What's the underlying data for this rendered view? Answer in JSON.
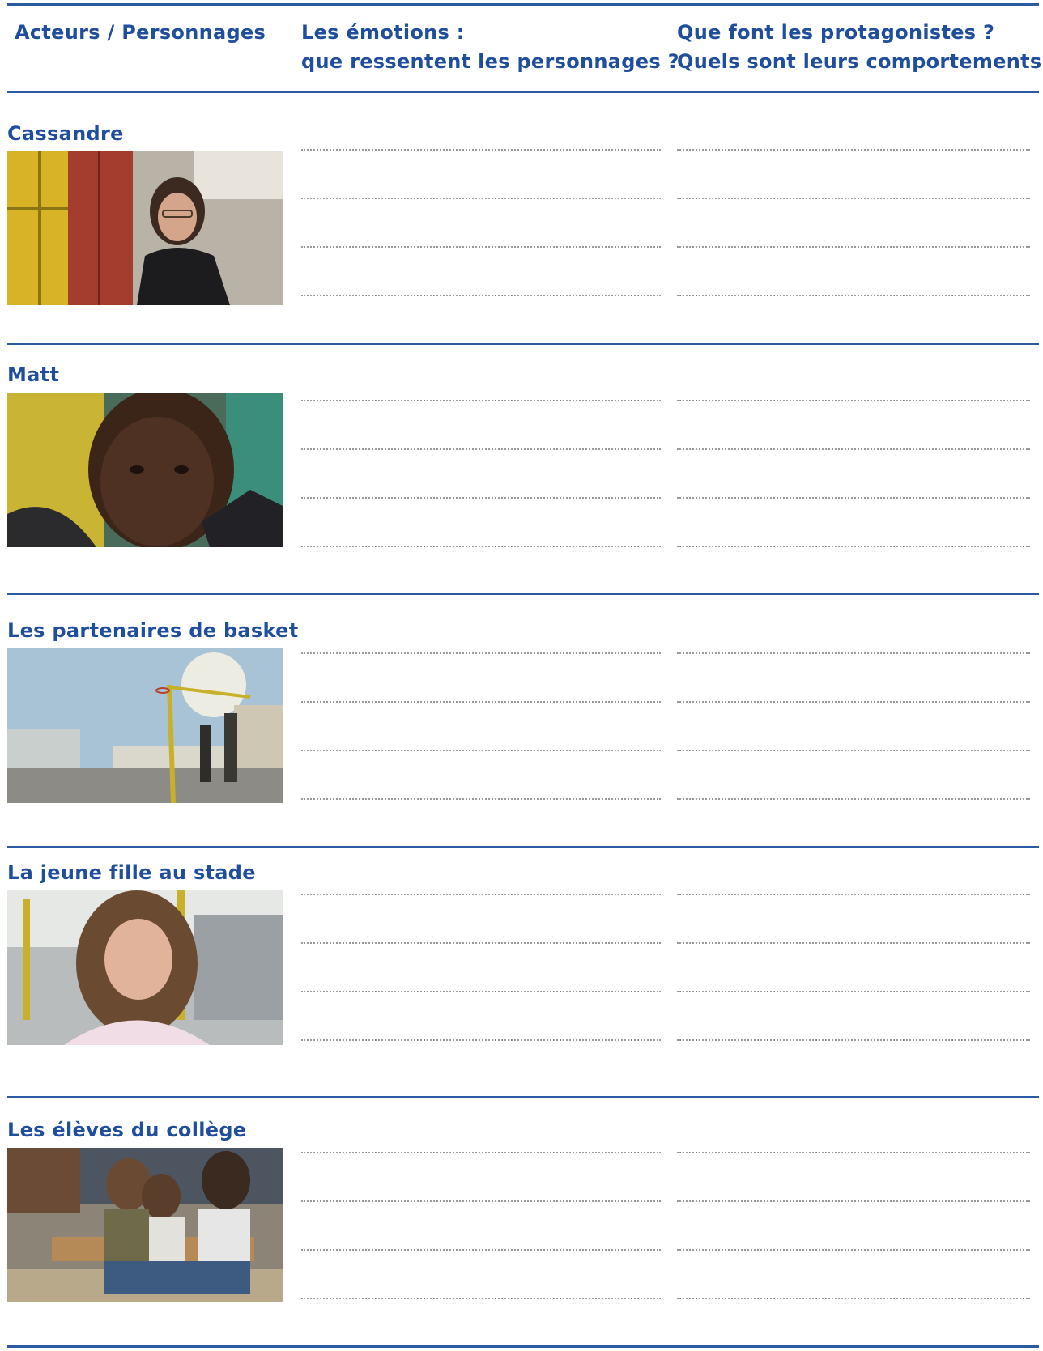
{
  "header": {
    "col1": "Acteurs / Personnages",
    "col2_line1": "Les émotions :",
    "col2_line2": "que ressentent les personnages ?",
    "col3_line1": "Que font les protagonistes ?",
    "col3_line2": "Quels sont leurs comportements ?"
  },
  "rows": [
    {
      "name": "Cassandre"
    },
    {
      "name": "Matt"
    },
    {
      "name": "Les partenaires de basket"
    },
    {
      "name": "La jeune fille au stade"
    },
    {
      "name": "Les élèves du collège"
    }
  ],
  "colors": {
    "accent": "#1f4e9c",
    "rule": "#2c5aa0",
    "dots": "#9a9a9a"
  }
}
